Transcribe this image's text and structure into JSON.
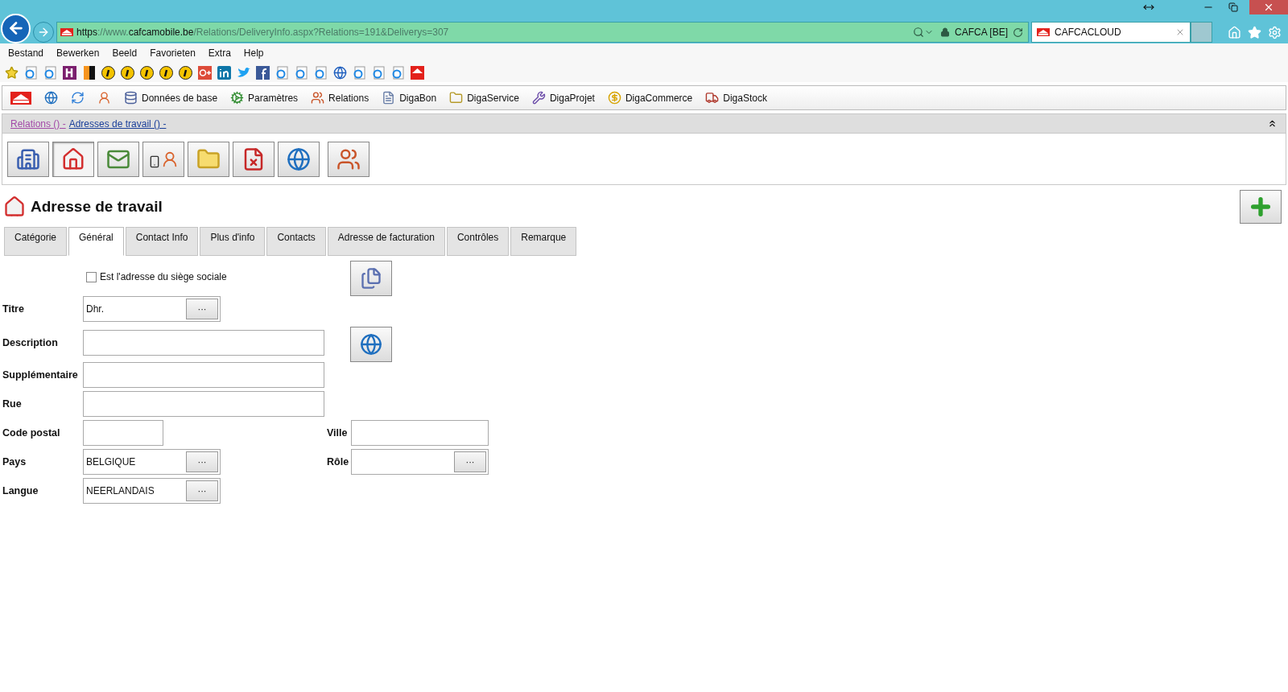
{
  "browser": {
    "url_parts": [
      {
        "text": "https",
        "emphasis": true
      },
      {
        "text": "://www.",
        "emphasis": false
      },
      {
        "text": "cafcamobile.be",
        "emphasis": true
      },
      {
        "text": "/Relations/DeliveryInfo.aspx?Relations=191&Deliverys=307",
        "emphasis": false
      }
    ],
    "site_identity": "CAFCA [BE]",
    "tabs": [
      {
        "title": "CAFCACLOUD",
        "selected": true
      }
    ],
    "menu": [
      "Bestand",
      "Bewerken",
      "Beeld",
      "Favorieten",
      "Extra",
      "Help"
    ],
    "favorites": [
      {
        "kind": "star"
      },
      {
        "kind": "ie"
      },
      {
        "kind": "ie"
      },
      {
        "kind": "h"
      },
      {
        "kind": "split"
      },
      {
        "kind": "info"
      },
      {
        "kind": "info"
      },
      {
        "kind": "info"
      },
      {
        "kind": "info"
      },
      {
        "kind": "info"
      },
      {
        "kind": "gplus"
      },
      {
        "kind": "linkedin"
      },
      {
        "kind": "bird"
      },
      {
        "kind": "facebook"
      },
      {
        "kind": "ie"
      },
      {
        "kind": "ie"
      },
      {
        "kind": "ie"
      },
      {
        "kind": "globe"
      },
      {
        "kind": "ie"
      },
      {
        "kind": "ie"
      },
      {
        "kind": "ie"
      },
      {
        "kind": "logo"
      }
    ]
  },
  "app_toolbar": [
    {
      "kind": "logo"
    },
    {
      "kind": "globe"
    },
    {
      "kind": "refresh"
    },
    {
      "kind": "user"
    },
    {
      "kind": "database",
      "label": "Données de base"
    },
    {
      "kind": "gears",
      "label": "Paramètres"
    },
    {
      "kind": "people",
      "label": "Relations"
    },
    {
      "kind": "document",
      "label": "DigaBon"
    },
    {
      "kind": "folder",
      "label": "DigaService"
    },
    {
      "kind": "tools",
      "label": "DigaProjet"
    },
    {
      "kind": "coin",
      "label": "DigaCommerce"
    },
    {
      "kind": "truck",
      "label": "DigaStock"
    }
  ],
  "breadcrumb": [
    {
      "text": "Relations () -",
      "visited": true
    },
    {
      "text": "Adresses de travail () -",
      "visited": false
    }
  ],
  "modules": [
    {
      "kind": "building",
      "selected": false
    },
    {
      "kind": "house",
      "selected": true
    },
    {
      "kind": "mail",
      "selected": false
    },
    {
      "kind": "phone-person",
      "selected": false
    },
    {
      "kind": "folder",
      "selected": false
    },
    {
      "kind": "no-document",
      "selected": false
    },
    {
      "kind": "globe",
      "selected": false
    },
    {
      "kind": "people",
      "selected": false
    }
  ],
  "page": {
    "title": "Adresse de travail"
  },
  "tabs": [
    {
      "label": "Catégorie",
      "selected": false
    },
    {
      "label": "Général",
      "selected": true
    },
    {
      "label": "Contact Info",
      "selected": false
    },
    {
      "label": "Plus d'info",
      "selected": false
    },
    {
      "label": "Contacts",
      "selected": false
    },
    {
      "label": "Adresse de facturation",
      "selected": false
    },
    {
      "label": "Contrôles",
      "selected": false
    },
    {
      "label": "Remarque",
      "selected": false
    }
  ],
  "form": {
    "checkbox": {
      "label": "Est l'adresse du siège sociale",
      "checked": false
    },
    "rows": [
      {
        "left": {
          "label": "Titre",
          "kind": "lookup",
          "value": "Dhr.",
          "button_text": "···"
        }
      },
      {
        "left": {
          "label": "Description",
          "kind": "long"
        }
      },
      {
        "left": {
          "label": "Supplémentaire",
          "kind": "long"
        }
      },
      {
        "left": {
          "label": "Rue",
          "kind": "long"
        }
      },
      {
        "left": {
          "label": "Code postal",
          "kind": "short"
        },
        "right": {
          "label": "Ville",
          "kind": "medium"
        }
      },
      {
        "left": {
          "label": "Pays",
          "kind": "lookup",
          "value": "BELGIQUE",
          "button_text": "···"
        },
        "right": {
          "label": "Rôle",
          "kind": "lookup-wide",
          "button_text": "···"
        }
      },
      {
        "left": {
          "label": "Langue",
          "kind": "lookup",
          "value": "NEERLANDAIS",
          "button_text": "···"
        }
      }
    ]
  }
}
